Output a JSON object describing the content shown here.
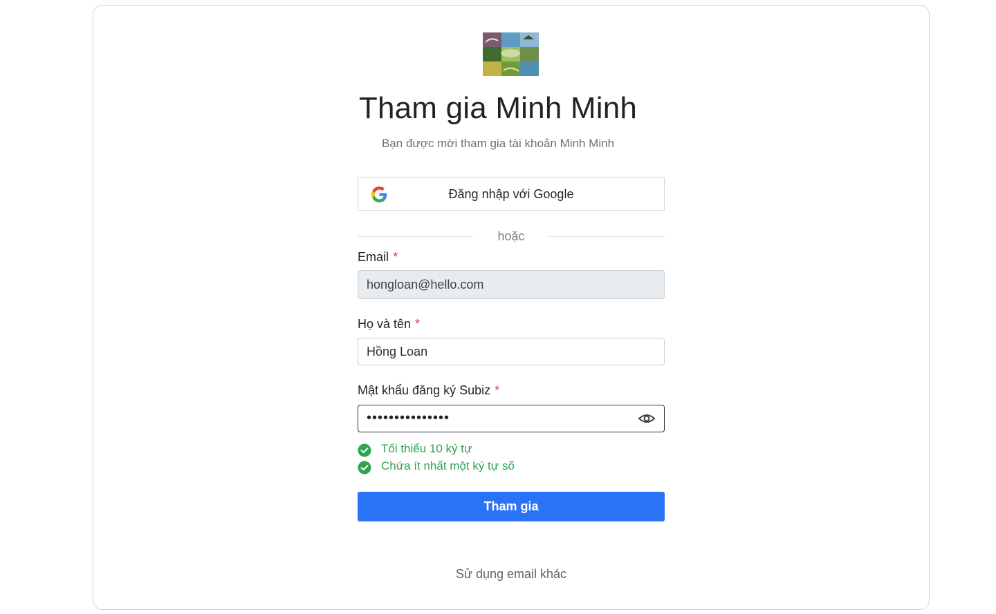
{
  "header": {
    "title": "Tham gia Minh Minh",
    "subtitle": "Bạn được mời tham gia tài khoản Minh Minh",
    "logo_icon": "landscape-collage-logo"
  },
  "google": {
    "label": "Đăng nhập với Google",
    "icon": "google-icon"
  },
  "divider": {
    "text": "hoặc"
  },
  "form": {
    "email": {
      "label": "Email",
      "required_mark": "*",
      "value": "hongloan@hello.com",
      "disabled": true
    },
    "fullname": {
      "label": "Họ và tên",
      "required_mark": "*",
      "value": "Hồng Loan"
    },
    "password": {
      "label": "Mật khẩu đăng ký Subiz",
      "required_mark": "*",
      "masked_value": "•••••••••••••••",
      "icon": "eye-icon"
    },
    "rules": [
      {
        "text": "Tối thiểu 10 ký tự",
        "passed": true
      },
      {
        "text": "Chứa ít nhất một ký tự số",
        "passed": true
      }
    ],
    "submit_label": "Tham gia"
  },
  "footer": {
    "alt_link": "Sử dụng email khác"
  },
  "colors": {
    "primary": "#2b73f6",
    "success": "#2ea44f",
    "required": "#e0393e"
  }
}
